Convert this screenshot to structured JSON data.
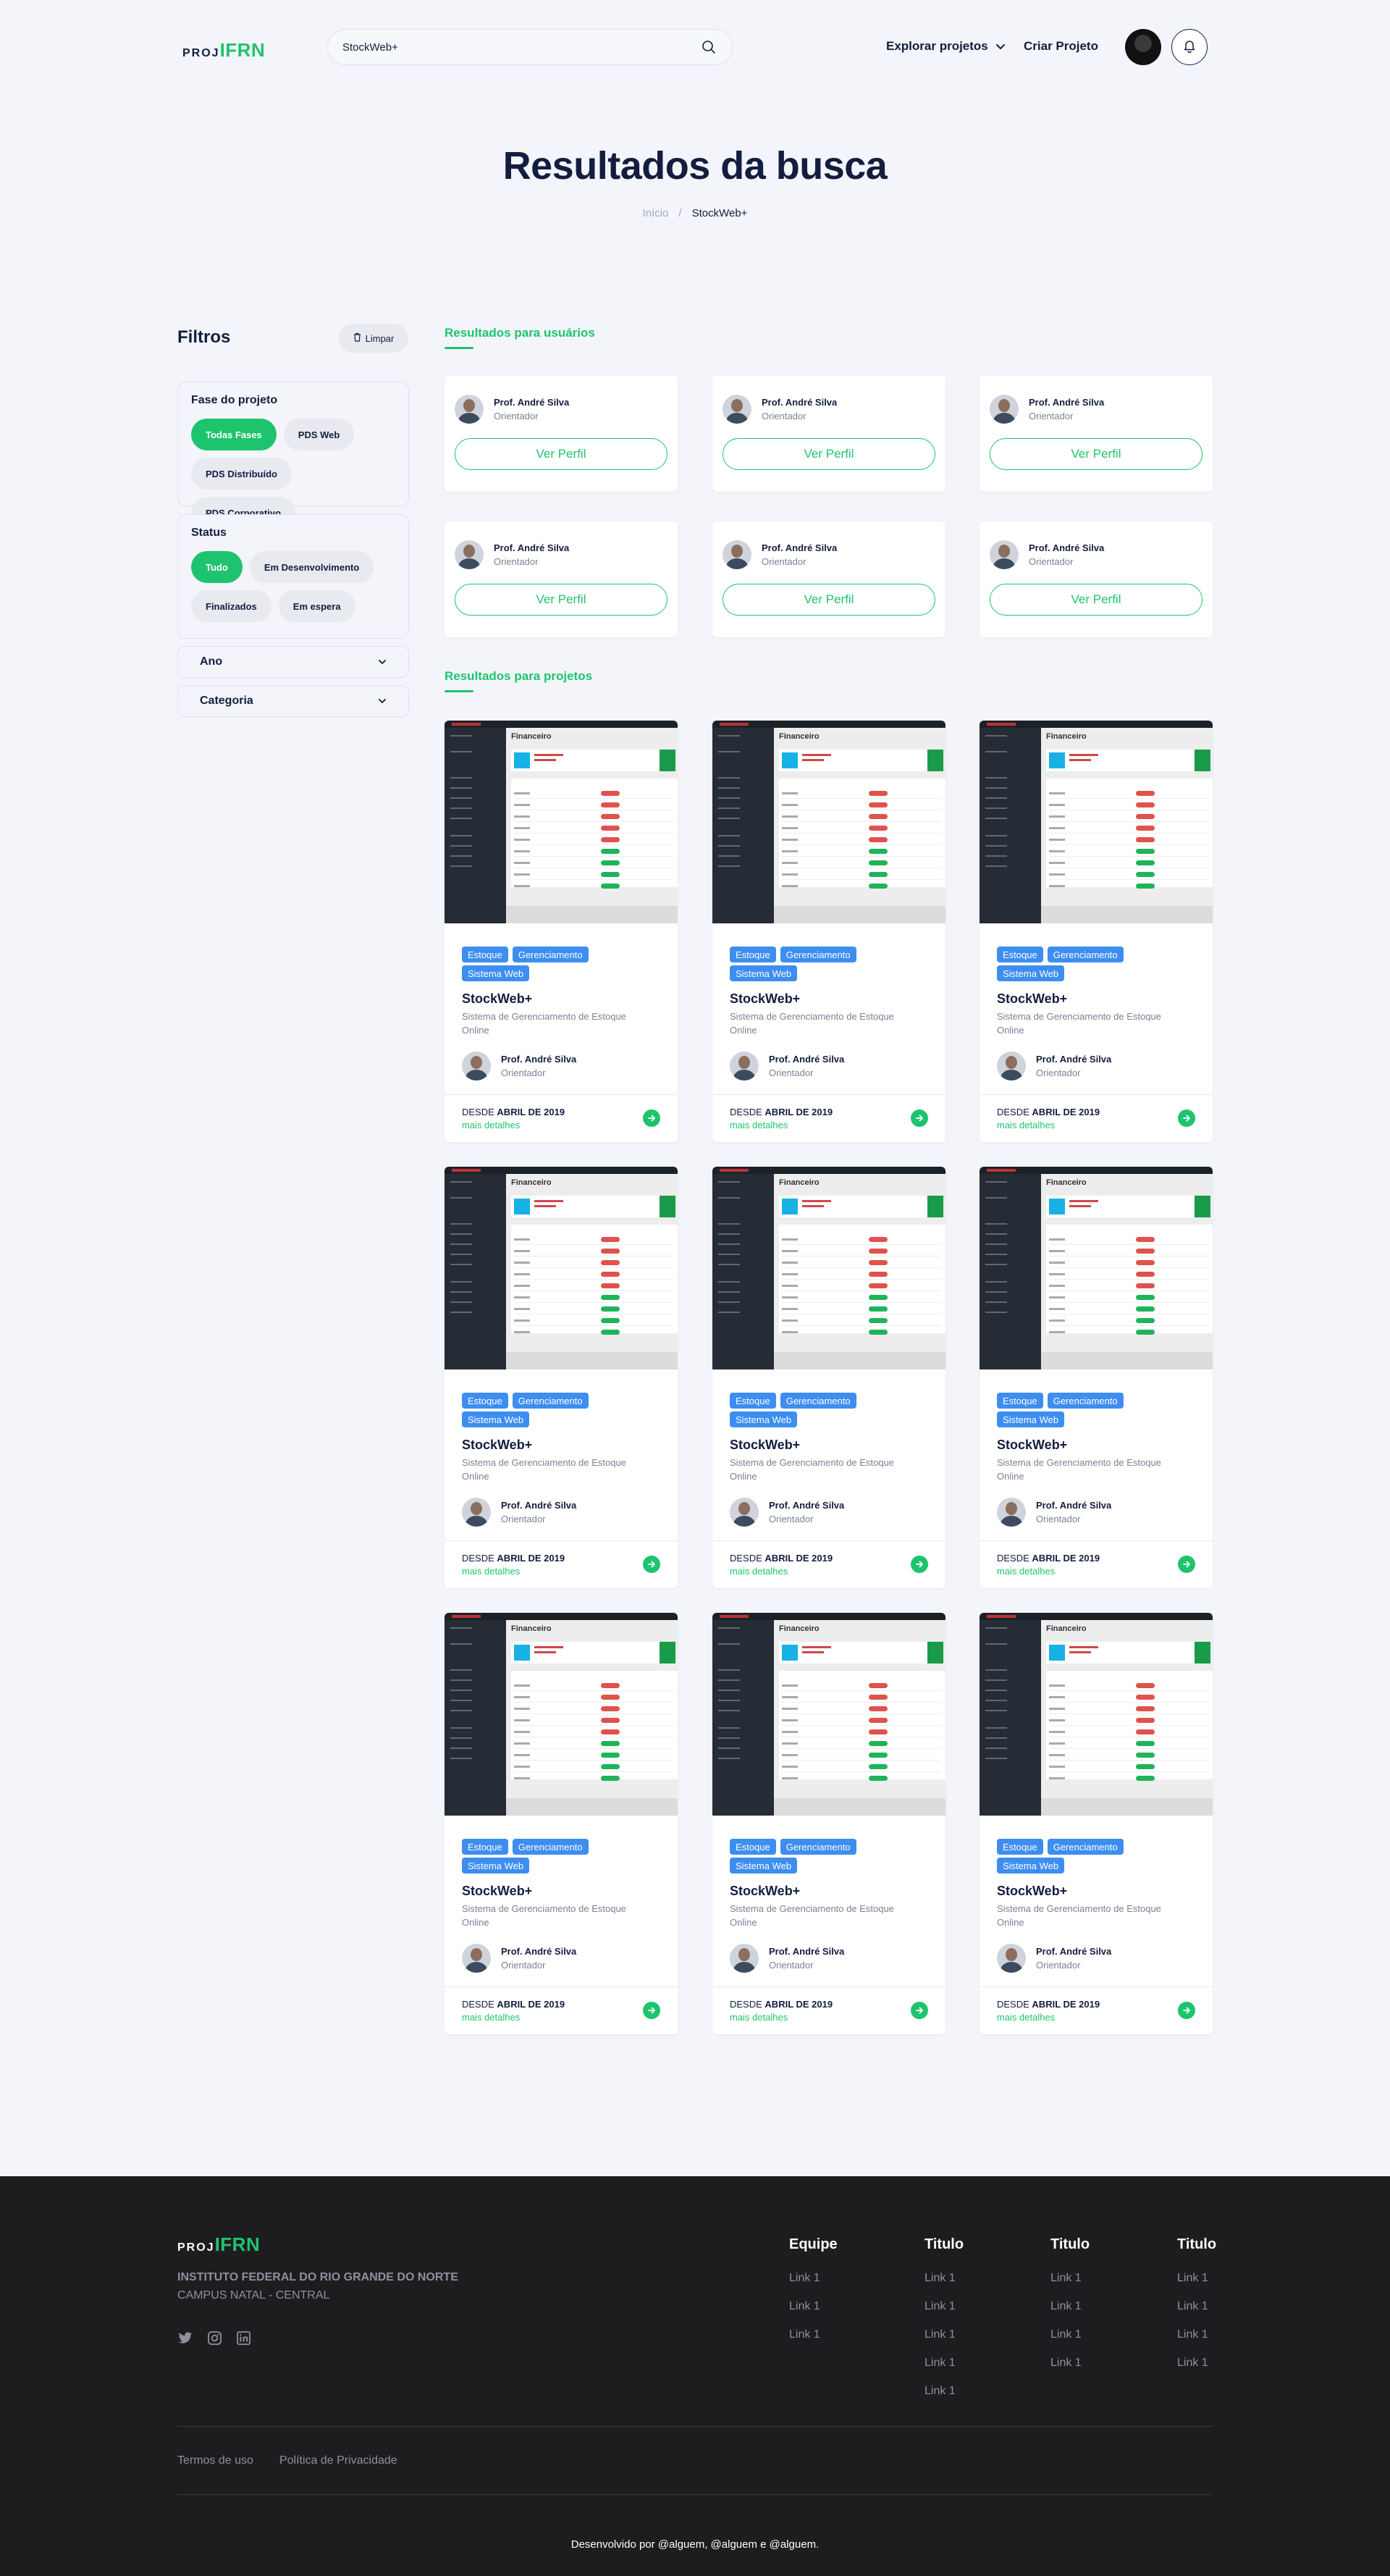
{
  "brand": {
    "prefix": "PROJ",
    "name": "IFRN",
    "accent": "#1ec46d",
    "dark": "#141d3f"
  },
  "search": {
    "value": "StockWeb+",
    "placeholder": ""
  },
  "nav": {
    "explore_label": "Explorar projetos",
    "create_label": "Criar Projeto"
  },
  "hero": {
    "title": "Resultados da busca",
    "breadcrumb": {
      "home": "Início",
      "separator": "/",
      "current": "StockWeb+"
    }
  },
  "sidebar": {
    "title": "Filtros",
    "clear_label": "Limpar",
    "phase": {
      "title": "Fase do projeto",
      "options": [
        "Todas Fases",
        "PDS Web",
        "PDS Distribuído",
        "PDS Corporativo"
      ],
      "selected": "Todas Fases"
    },
    "status": {
      "title": "Status",
      "options": [
        "Tudo",
        "Em Desenvolvimento",
        "Finalizados",
        "Em espera"
      ],
      "selected": "Tudo"
    },
    "dropdowns": [
      "Ano",
      "Categoria"
    ]
  },
  "users_section": {
    "title": "Resultados para usuários",
    "button_label": "Ver Perfil",
    "users": [
      {
        "name": "Prof. André Silva",
        "role": "Orientador"
      },
      {
        "name": "Prof. André Silva",
        "role": "Orientador"
      },
      {
        "name": "Prof. André Silva",
        "role": "Orientador"
      },
      {
        "name": "Prof. André Silva",
        "role": "Orientador"
      },
      {
        "name": "Prof. André Silva",
        "role": "Orientador"
      },
      {
        "name": "Prof. André Silva",
        "role": "Orientador"
      }
    ]
  },
  "projects_section": {
    "title": "Resultados para projetos",
    "screenshot_title": "Financeiro",
    "projects": [
      {
        "tags": [
          "Estoque",
          "Gerenciamento",
          "Sistema Web"
        ],
        "title": "StockWeb+",
        "description": "Sistema de Gerenciamento de Estoque Online",
        "author": "Prof. André Silva",
        "role": "Orientador",
        "since_prefix": "DESDE",
        "since_date": "ABRIL DE 2019",
        "more_label": "mais detalhes"
      },
      {
        "tags": [
          "Estoque",
          "Gerenciamento",
          "Sistema Web"
        ],
        "title": "StockWeb+",
        "description": "Sistema de Gerenciamento de Estoque Online",
        "author": "Prof. André Silva",
        "role": "Orientador",
        "since_prefix": "DESDE",
        "since_date": "ABRIL DE 2019",
        "more_label": "mais detalhes"
      },
      {
        "tags": [
          "Estoque",
          "Gerenciamento",
          "Sistema Web"
        ],
        "title": "StockWeb+",
        "description": "Sistema de Gerenciamento de Estoque Online",
        "author": "Prof. André Silva",
        "role": "Orientador",
        "since_prefix": "DESDE",
        "since_date": "ABRIL DE 2019",
        "more_label": "mais detalhes"
      },
      {
        "tags": [
          "Estoque",
          "Gerenciamento",
          "Sistema Web"
        ],
        "title": "StockWeb+",
        "description": "Sistema de Gerenciamento de Estoque Online",
        "author": "Prof. André Silva",
        "role": "Orientador",
        "since_prefix": "DESDE",
        "since_date": "ABRIL DE 2019",
        "more_label": "mais detalhes"
      },
      {
        "tags": [
          "Estoque",
          "Gerenciamento",
          "Sistema Web"
        ],
        "title": "StockWeb+",
        "description": "Sistema de Gerenciamento de Estoque Online",
        "author": "Prof. André Silva",
        "role": "Orientador",
        "since_prefix": "DESDE",
        "since_date": "ABRIL DE 2019",
        "more_label": "mais detalhes"
      },
      {
        "tags": [
          "Estoque",
          "Gerenciamento",
          "Sistema Web"
        ],
        "title": "StockWeb+",
        "description": "Sistema de Gerenciamento de Estoque Online",
        "author": "Prof. André Silva",
        "role": "Orientador",
        "since_prefix": "DESDE",
        "since_date": "ABRIL DE 2019",
        "more_label": "mais detalhes"
      },
      {
        "tags": [
          "Estoque",
          "Gerenciamento",
          "Sistema Web"
        ],
        "title": "StockWeb+",
        "description": "Sistema de Gerenciamento de Estoque Online",
        "author": "Prof. André Silva",
        "role": "Orientador",
        "since_prefix": "DESDE",
        "since_date": "ABRIL DE 2019",
        "more_label": "mais detalhes"
      },
      {
        "tags": [
          "Estoque",
          "Gerenciamento",
          "Sistema Web"
        ],
        "title": "StockWeb+",
        "description": "Sistema de Gerenciamento de Estoque Online",
        "author": "Prof. André Silva",
        "role": "Orientador",
        "since_prefix": "DESDE",
        "since_date": "ABRIL DE 2019",
        "more_label": "mais detalhes"
      },
      {
        "tags": [
          "Estoque",
          "Gerenciamento",
          "Sistema Web"
        ],
        "title": "StockWeb+",
        "description": "Sistema de Gerenciamento de Estoque Online",
        "author": "Prof. André Silva",
        "role": "Orientador",
        "since_prefix": "DESDE",
        "since_date": "ABRIL DE 2019",
        "more_label": "mais detalhes"
      }
    ]
  },
  "footer": {
    "institution": "INSTITUTO FEDERAL DO RIO GRANDE DO NORTE",
    "campus": "CAMPUS NATAL - CENTRAL",
    "social_icons": [
      "twitter-icon",
      "instagram-icon",
      "linkedin-icon"
    ],
    "columns": [
      {
        "title": "Equipe",
        "links": [
          "Link 1",
          "Link 1",
          "Link 1"
        ]
      },
      {
        "title": "Titulo",
        "links": [
          "Link 1",
          "Link 1",
          "Link 1",
          "Link 1",
          "Link 1"
        ]
      },
      {
        "title": "Titulo",
        "links": [
          "Link 1",
          "Link 1",
          "Link 1",
          "Link 1"
        ]
      },
      {
        "title": "Titulo",
        "links": [
          "Link 1",
          "Link 1",
          "Link 1",
          "Link 1"
        ]
      }
    ],
    "legal": [
      "Termos de uso",
      "Política de Privacidade"
    ],
    "credits": "Desenvolvido por @alguem, @alguem e @alguem."
  }
}
